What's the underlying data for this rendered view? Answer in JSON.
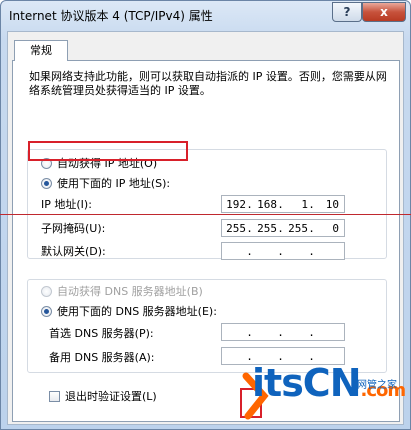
{
  "window": {
    "title": "Internet 协议版本 4 (TCP/IPv4) 属性",
    "help_label": "?",
    "close_label": "x"
  },
  "tabs": [
    {
      "label": "常规"
    }
  ],
  "description": "如果网络支持此功能，则可以获取自动指派的 IP 设置。否则，您需要从网络系统管理员处获得适当的 IP 设置。",
  "ip_section": {
    "auto_label": "自动获得 IP 地址(O)",
    "manual_label": "使用下面的 IP 地址(S):",
    "ip_label": "IP 地址(I):",
    "ip_value": [
      "192",
      "168",
      "1",
      "10"
    ],
    "mask_label": "子网掩码(U):",
    "mask_value": [
      "255",
      "255",
      "255",
      "0"
    ],
    "gateway_label": "默认网关(D):",
    "gateway_value": [
      "",
      "",
      "",
      ""
    ]
  },
  "dns_section": {
    "auto_label": "自动获得 DNS 服务器地址(B)",
    "manual_label": "使用下面的 DNS 服务器地址(E):",
    "preferred_label": "首选 DNS 服务器(P):",
    "alternate_label": "备用 DNS 服务器(A):"
  },
  "validate_label": "退出时验证设置(L)",
  "watermark": {
    "logo_a": "itsCN",
    "logo_b": ".com",
    "sub": "网管之家"
  },
  "colors": {
    "highlight": "#d8202a",
    "titlebar": "#c7d9ef",
    "logo_blue": "#0f63bd",
    "logo_orange": "#ff6600"
  }
}
